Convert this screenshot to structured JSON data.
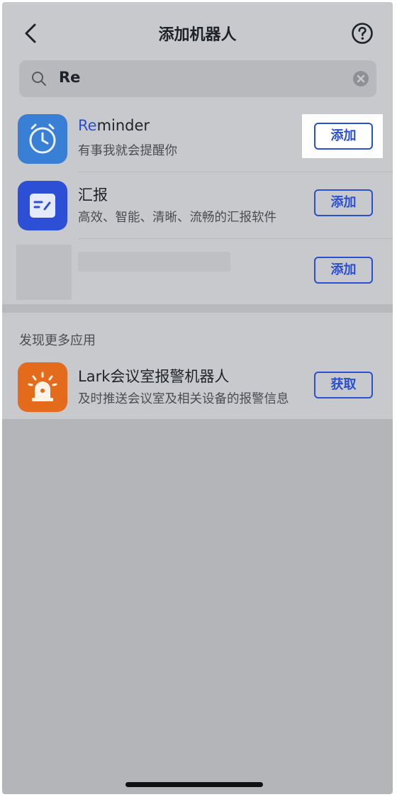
{
  "header": {
    "title": "添加机器人",
    "back_icon": "chevron-left-icon",
    "help_icon": "question-circle-icon"
  },
  "search": {
    "value": "Re",
    "search_icon": "search-icon",
    "clear_icon": "clear-circle-icon"
  },
  "results": [
    {
      "name_highlight": "Re",
      "name_rest": "minder",
      "desc": "有事我就会提醒你",
      "button": "添加",
      "icon": "alarm-clock-icon"
    },
    {
      "name": "汇报",
      "desc": "高效、智能、清晰、流畅的汇报软件",
      "button": "添加",
      "icon": "report-icon"
    },
    {
      "button": "添加"
    }
  ],
  "more_section": {
    "title": "发现更多应用",
    "items": [
      {
        "name": "Lark会议室报警机器人",
        "desc": "及时推送会议室及相关设备的报警信息",
        "button": "获取",
        "icon": "alarm-light-icon"
      }
    ]
  },
  "colors": {
    "accent": "#2a4fd0",
    "overlay": "#b4b5b8",
    "reminder_icon_bg": "#3a7fd6",
    "report_icon_bg": "#2d4fd6",
    "lark_icon_bg": "#e46a1c"
  }
}
